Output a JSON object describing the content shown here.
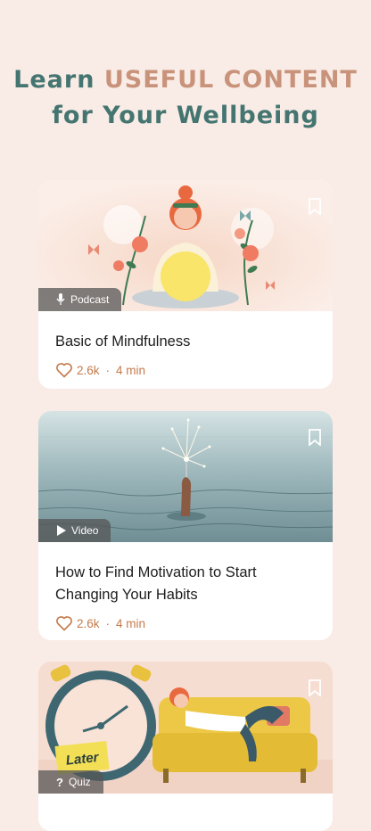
{
  "header": {
    "line1_plain": "Learn",
    "line1_accent": "USEFUL CONTENT",
    "line2": "for Your Wellbeing"
  },
  "cards": [
    {
      "badge": "Podcast",
      "badge_icon": "microphone-icon",
      "title": "Basic of Mindfulness",
      "likes": "2.6k",
      "separator": "·",
      "duration": "4 min"
    },
    {
      "badge": "Video",
      "badge_icon": "play-icon",
      "title": "How to Find Motivation to Start Changing Your Habits",
      "likes": "2.6k",
      "separator": "·",
      "duration": "4 min"
    },
    {
      "badge": "Quiz",
      "badge_icon": "question-icon",
      "image_text": "Later"
    }
  ],
  "colors": {
    "background": "#f9ebe5",
    "headline": "#447570",
    "accent": "#c8937a",
    "meta": "#c57a4b"
  }
}
